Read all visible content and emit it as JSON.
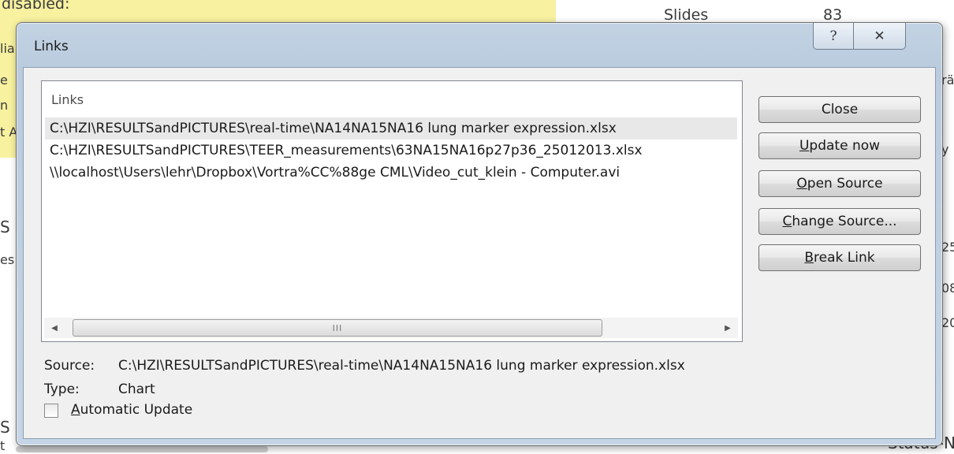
{
  "background": {
    "top_left_text": "disabled:",
    "side_fragments": [
      "lia",
      "e",
      "n",
      "t A",
      "S",
      "es",
      "S",
      "t"
    ],
    "right_label": "Slides",
    "right_value": "83",
    "right_fragments": [
      "rä",
      "y",
      "25",
      "08",
      "20"
    ],
    "bottom_right_text": "Status-N"
  },
  "dialog": {
    "title": "Links",
    "help_icon": "?",
    "close_icon": "✕"
  },
  "links_list": {
    "header": "Links",
    "items": [
      "C:\\HZI\\RESULTSandPICTURES\\real-time\\NA14NA15NA16 lung marker expression.xlsx",
      "C:\\HZI\\RESULTSandPICTURES\\TEER_measurements\\63NA15NA16p27p36_25012013.xlsx",
      "\\\\localhost\\Users\\lehr\\Dropbox\\Vortra%CC%88ge CML\\Video_cut_klein - Computer.avi"
    ],
    "scroll_thumb_grip": "III"
  },
  "buttons": {
    "close": "Close",
    "update_now_mnemonic": "U",
    "update_now_rest": "pdate now",
    "open_source_mnemonic": "O",
    "open_source_rest": "pen Source",
    "change_source_mnemonic": "C",
    "change_source_rest": "hange Source...",
    "break_link_mnemonic": "B",
    "break_link_rest": "reak Link"
  },
  "details": {
    "source_label": "Source:",
    "source_value": "C:\\HZI\\RESULTSandPICTURES\\real-time\\NA14NA15NA16 lung marker expression.xlsx",
    "type_label": "Type:",
    "type_value": "Chart",
    "auto_update_mnemonic": "A",
    "auto_update_rest": "utomatic Update",
    "auto_update_checked": false
  }
}
